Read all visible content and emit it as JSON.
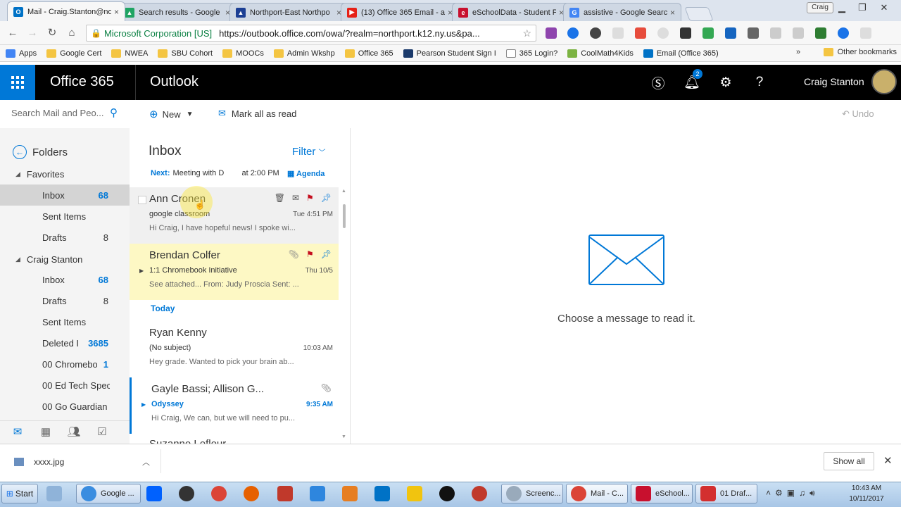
{
  "browser": {
    "tabs": [
      {
        "title": "Mail - Craig.Stanton@no",
        "icon": "outlook-icon",
        "color": "#0072c6",
        "active": true
      },
      {
        "title": "Search results - Google D",
        "icon": "drive-icon",
        "color": "#1fa463"
      },
      {
        "title": "Northport-East Northpo",
        "icon": "school-icon",
        "color": "#1c3f94"
      },
      {
        "title": "(13) Office 365 Email - a",
        "icon": "youtube-icon",
        "color": "#e62117"
      },
      {
        "title": "eSchoolData - Student P",
        "icon": "esd-icon",
        "color": "#c8102e"
      },
      {
        "title": "assistive - Google Searc",
        "icon": "google-icon",
        "color": "#4285f4"
      }
    ],
    "profile": "Craig",
    "address": {
      "org": "Microsoft Corporation [US]",
      "url": "https://outbook.office.com/owa/?realm=northport.k12.ny.us&pa..."
    },
    "bookmarks": [
      {
        "label": "Apps",
        "icon": "apps-icon"
      },
      {
        "label": "Google Cert",
        "icon": "folder-icon"
      },
      {
        "label": "NWEA",
        "icon": "folder-icon"
      },
      {
        "label": "SBU Cohort",
        "icon": "folder-icon"
      },
      {
        "label": "MOOCs",
        "icon": "folder-icon"
      },
      {
        "label": "Admin Wkshp",
        "icon": "folder-icon"
      },
      {
        "label": "Office 365",
        "icon": "office-icon"
      },
      {
        "label": "Pearson Student Sign I",
        "icon": "pearson-icon"
      },
      {
        "label": "365 Login?",
        "icon": "page-icon"
      },
      {
        "label": "CoolMath4Kids",
        "icon": "coolmath-icon"
      },
      {
        "label": "Email (Office 365)",
        "icon": "outlook-icon"
      }
    ],
    "other_bookmarks": "Other bookmarks"
  },
  "o365": {
    "brand": "Office 365",
    "app": "Outlook",
    "notifications": "2",
    "user": "Craig Stanton"
  },
  "commands": {
    "search_placeholder": "Search Mail and Peo...",
    "new": "New",
    "mark_all_read": "Mark all as read",
    "undo": "Undo"
  },
  "nav": {
    "folders": "Folders",
    "favorites_header": "Favorites",
    "favorites": [
      {
        "label": "Inbox",
        "count": "68",
        "selected": true
      },
      {
        "label": "Sent Items",
        "count": ""
      },
      {
        "label": "Drafts",
        "count": "8"
      }
    ],
    "account_header": "Craig Stanton",
    "account": [
      {
        "label": "Inbox",
        "count": "68",
        "blue": true
      },
      {
        "label": "Drafts",
        "count": "8"
      },
      {
        "label": "Sent Items",
        "count": ""
      },
      {
        "label": "Deleted I",
        "count": "3685",
        "blue": true
      },
      {
        "label": "00 Chromebo",
        "count": "1",
        "blue": true
      },
      {
        "label": "00 Ed Tech Spec",
        "count": ""
      },
      {
        "label": "00 Go Guardian",
        "count": ""
      }
    ]
  },
  "list": {
    "title": "Inbox",
    "filter": "Filter",
    "next_label": "Next:",
    "next_event": "Meeting with D",
    "next_time": "at 2:00 PM",
    "agenda": "Agenda",
    "today": "Today",
    "messages": [
      {
        "from": "Ann Cronen",
        "subject": "google classroom",
        "time": "Tue 4:51 PM",
        "preview": "Hi Craig,  I have hopeful news! I spoke wi..."
      },
      {
        "from": "Brendan Colfer",
        "subject": "1:1 Chromebook Initiative",
        "time": "Thu 10/5",
        "preview": "See attached...  From: Judy Proscia Sent: ..."
      },
      {
        "from": "Ryan Kenny",
        "subject": "(No subject)",
        "time": "10:03 AM",
        "preview": "Hey grade. Wanted to pick your brain ab..."
      },
      {
        "from": "Gayle Bassi; Allison G...",
        "subject": "Odyssey",
        "time": "9:35 AM",
        "preview": "Hi Craig,  We can, but we will need to pu..."
      },
      {
        "from": "Suzanne Lefleur",
        "subject": "",
        "time": "",
        "preview": ""
      }
    ]
  },
  "reading": {
    "empty_text": "Choose a message to read it."
  },
  "download": {
    "file": "xxxx.jpg",
    "show_all": "Show all"
  },
  "taskbar": {
    "start": "Start",
    "items": [
      "Google ...",
      "Screenc...",
      "Mail - C...",
      "eSchool...",
      "01 Draf..."
    ],
    "time": "10:43 AM",
    "date": "10/11/2017"
  },
  "colors": {
    "accent": "#0078d7",
    "header": "#000000",
    "pinned_highlight": "#fdf8c4",
    "flag": "#c50f1f"
  }
}
